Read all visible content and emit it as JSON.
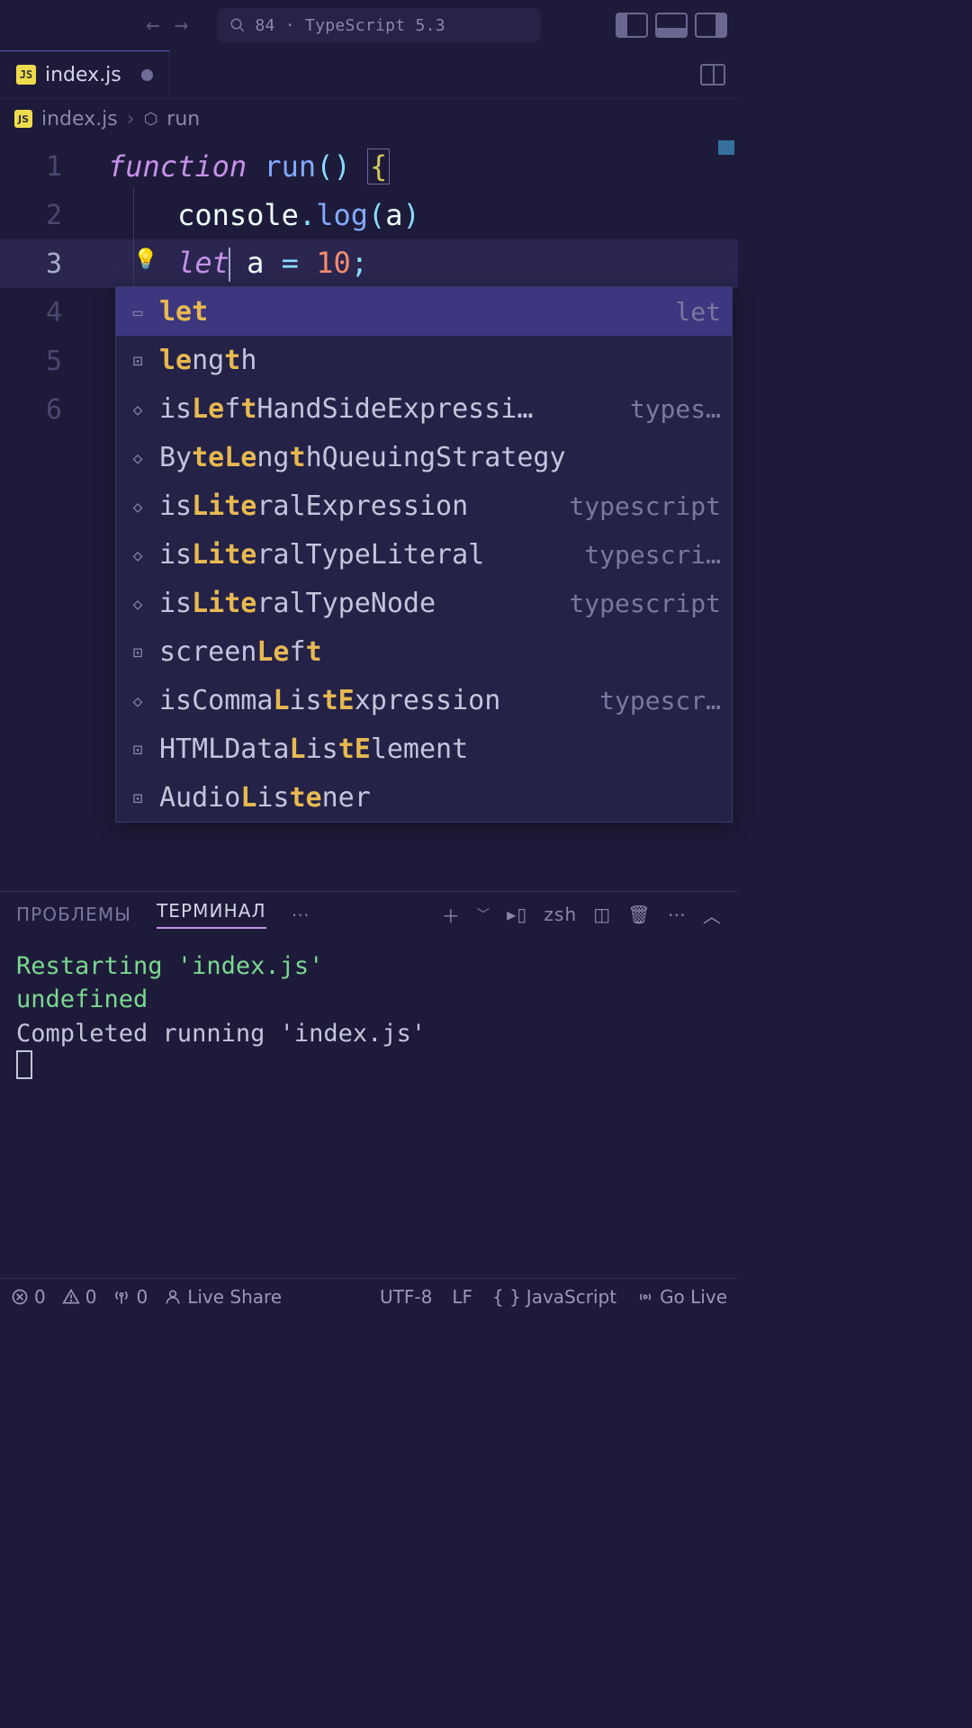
{
  "titlebar": {
    "search_text": "84 · TypeScript 5.3"
  },
  "tab": {
    "filename": "index.js",
    "modified": true
  },
  "breadcrumb": {
    "file": "index.js",
    "symbol": "run"
  },
  "code": {
    "lines": [
      {
        "n": 1
      },
      {
        "n": 2
      },
      {
        "n": 3
      },
      {
        "n": 4
      },
      {
        "n": 5
      },
      {
        "n": 6
      }
    ]
  },
  "autocomplete": {
    "filter_text": "let",
    "items": [
      {
        "icon": "keyword",
        "pre": "",
        "hl": "let",
        "post": "",
        "detail": "let",
        "selected": true
      },
      {
        "icon": "field",
        "pre": "",
        "hl": "le",
        "post": "ng",
        "hl2": "t",
        "post2": "h",
        "detail": ""
      },
      {
        "icon": "method",
        "pre": "is",
        "hl": "Le",
        "post": "f",
        "hl2": "t",
        "post2": "HandSideExpressi…",
        "detail": "types…"
      },
      {
        "icon": "method",
        "pre": "By",
        "hl": "teLe",
        "post": "ng",
        "hl2": "t",
        "post2": "hQueuingStrategy",
        "detail": ""
      },
      {
        "icon": "method",
        "pre": "is",
        "hl": "Lite",
        "post": "ralExpression",
        "detail": "typescript"
      },
      {
        "icon": "method",
        "pre": "is",
        "hl": "Lite",
        "post": "ralTypeLiteral",
        "detail": "typescri…"
      },
      {
        "icon": "method",
        "pre": "is",
        "hl": "Lite",
        "post": "ralTypeNode",
        "detail": "typescript"
      },
      {
        "icon": "field",
        "pre": "screen",
        "hl": "Le",
        "post": "f",
        "hl2": "t",
        "post2": "",
        "detail": ""
      },
      {
        "icon": "method",
        "pre": "isComma",
        "hl": "L",
        "post": "is",
        "hl2": "tE",
        "post2": "xpression",
        "detail": "typescr…"
      },
      {
        "icon": "field",
        "pre": "HTMLData",
        "hl": "L",
        "post": "is",
        "hl2": "tE",
        "post2": "lement",
        "detail": ""
      },
      {
        "icon": "field",
        "pre": "Audio",
        "hl": "L",
        "post": "is",
        "hl2": "te",
        "post2": "ner",
        "detail": ""
      }
    ]
  },
  "panel": {
    "tabs": {
      "problems": "ПРОБЛЕМЫ",
      "terminal": "ТЕРМИНАЛ"
    },
    "shell": "zsh",
    "output": {
      "l1a": "Restarting ",
      "l1b": "'index.js'",
      "l2": "undefined",
      "l3a": "Completed running ",
      "l3b": "'index.js'"
    }
  },
  "status": {
    "errors": "0",
    "warnings": "0",
    "ports": "0",
    "liveshare": "Live Share",
    "encoding": "UTF-8",
    "eol": "LF",
    "lang": "JavaScript",
    "golive": "Go Live"
  }
}
